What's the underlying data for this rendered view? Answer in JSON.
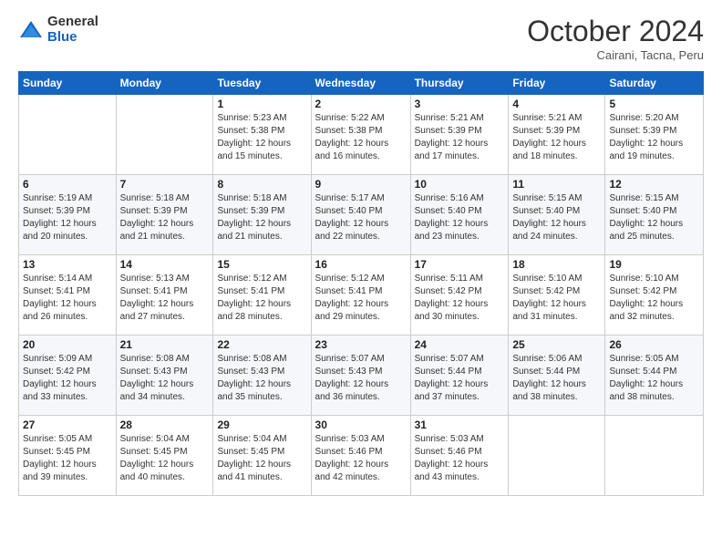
{
  "logo": {
    "general": "General",
    "blue": "Blue"
  },
  "header": {
    "month": "October 2024",
    "location": "Cairani, Tacna, Peru"
  },
  "weekdays": [
    "Sunday",
    "Monday",
    "Tuesday",
    "Wednesday",
    "Thursday",
    "Friday",
    "Saturday"
  ],
  "weeks": [
    [
      null,
      null,
      {
        "day": 1,
        "sunrise": "5:23 AM",
        "sunset": "5:38 PM",
        "daylight": "12 hours and 15 minutes."
      },
      {
        "day": 2,
        "sunrise": "5:22 AM",
        "sunset": "5:38 PM",
        "daylight": "12 hours and 16 minutes."
      },
      {
        "day": 3,
        "sunrise": "5:21 AM",
        "sunset": "5:39 PM",
        "daylight": "12 hours and 17 minutes."
      },
      {
        "day": 4,
        "sunrise": "5:21 AM",
        "sunset": "5:39 PM",
        "daylight": "12 hours and 18 minutes."
      },
      {
        "day": 5,
        "sunrise": "5:20 AM",
        "sunset": "5:39 PM",
        "daylight": "12 hours and 19 minutes."
      }
    ],
    [
      {
        "day": 6,
        "sunrise": "5:19 AM",
        "sunset": "5:39 PM",
        "daylight": "12 hours and 20 minutes."
      },
      {
        "day": 7,
        "sunrise": "5:18 AM",
        "sunset": "5:39 PM",
        "daylight": "12 hours and 21 minutes."
      },
      {
        "day": 8,
        "sunrise": "5:18 AM",
        "sunset": "5:39 PM",
        "daylight": "12 hours and 21 minutes."
      },
      {
        "day": 9,
        "sunrise": "5:17 AM",
        "sunset": "5:40 PM",
        "daylight": "12 hours and 22 minutes."
      },
      {
        "day": 10,
        "sunrise": "5:16 AM",
        "sunset": "5:40 PM",
        "daylight": "12 hours and 23 minutes."
      },
      {
        "day": 11,
        "sunrise": "5:15 AM",
        "sunset": "5:40 PM",
        "daylight": "12 hours and 24 minutes."
      },
      {
        "day": 12,
        "sunrise": "5:15 AM",
        "sunset": "5:40 PM",
        "daylight": "12 hours and 25 minutes."
      }
    ],
    [
      {
        "day": 13,
        "sunrise": "5:14 AM",
        "sunset": "5:41 PM",
        "daylight": "12 hours and 26 minutes."
      },
      {
        "day": 14,
        "sunrise": "5:13 AM",
        "sunset": "5:41 PM",
        "daylight": "12 hours and 27 minutes."
      },
      {
        "day": 15,
        "sunrise": "5:12 AM",
        "sunset": "5:41 PM",
        "daylight": "12 hours and 28 minutes."
      },
      {
        "day": 16,
        "sunrise": "5:12 AM",
        "sunset": "5:41 PM",
        "daylight": "12 hours and 29 minutes."
      },
      {
        "day": 17,
        "sunrise": "5:11 AM",
        "sunset": "5:42 PM",
        "daylight": "12 hours and 30 minutes."
      },
      {
        "day": 18,
        "sunrise": "5:10 AM",
        "sunset": "5:42 PM",
        "daylight": "12 hours and 31 minutes."
      },
      {
        "day": 19,
        "sunrise": "5:10 AM",
        "sunset": "5:42 PM",
        "daylight": "12 hours and 32 minutes."
      }
    ],
    [
      {
        "day": 20,
        "sunrise": "5:09 AM",
        "sunset": "5:42 PM",
        "daylight": "12 hours and 33 minutes."
      },
      {
        "day": 21,
        "sunrise": "5:08 AM",
        "sunset": "5:43 PM",
        "daylight": "12 hours and 34 minutes."
      },
      {
        "day": 22,
        "sunrise": "5:08 AM",
        "sunset": "5:43 PM",
        "daylight": "12 hours and 35 minutes."
      },
      {
        "day": 23,
        "sunrise": "5:07 AM",
        "sunset": "5:43 PM",
        "daylight": "12 hours and 36 minutes."
      },
      {
        "day": 24,
        "sunrise": "5:07 AM",
        "sunset": "5:44 PM",
        "daylight": "12 hours and 37 minutes."
      },
      {
        "day": 25,
        "sunrise": "5:06 AM",
        "sunset": "5:44 PM",
        "daylight": "12 hours and 38 minutes."
      },
      {
        "day": 26,
        "sunrise": "5:05 AM",
        "sunset": "5:44 PM",
        "daylight": "12 hours and 38 minutes."
      }
    ],
    [
      {
        "day": 27,
        "sunrise": "5:05 AM",
        "sunset": "5:45 PM",
        "daylight": "12 hours and 39 minutes."
      },
      {
        "day": 28,
        "sunrise": "5:04 AM",
        "sunset": "5:45 PM",
        "daylight": "12 hours and 40 minutes."
      },
      {
        "day": 29,
        "sunrise": "5:04 AM",
        "sunset": "5:45 PM",
        "daylight": "12 hours and 41 minutes."
      },
      {
        "day": 30,
        "sunrise": "5:03 AM",
        "sunset": "5:46 PM",
        "daylight": "12 hours and 42 minutes."
      },
      {
        "day": 31,
        "sunrise": "5:03 AM",
        "sunset": "5:46 PM",
        "daylight": "12 hours and 43 minutes."
      },
      null,
      null
    ]
  ]
}
